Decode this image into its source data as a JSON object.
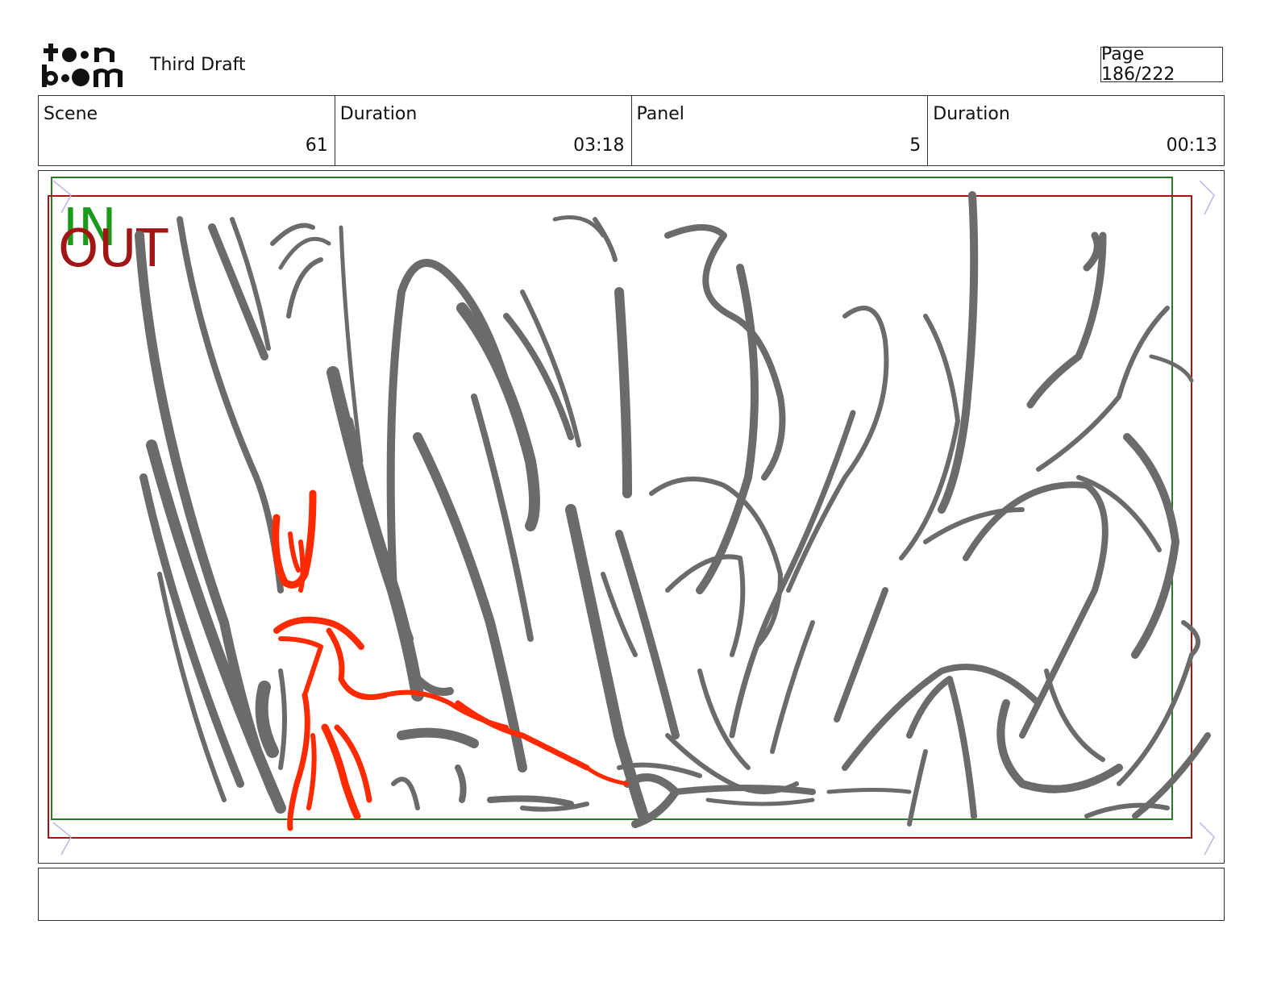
{
  "header": {
    "logo_text_top": "toon",
    "logo_text_bottom": "boom",
    "document_title": "Third Draft",
    "page_label": "Page 186/222"
  },
  "info": {
    "scene_label": "Scene",
    "scene_value": "61",
    "scene_duration_label": "Duration",
    "scene_duration_value": "03:18",
    "panel_label": "Panel",
    "panel_value": "5",
    "panel_duration_label": "Duration",
    "panel_duration_value": "00:13"
  },
  "panel": {
    "in_label": "IN",
    "out_label": "OUT",
    "in_color": "#1a9a1a",
    "out_color": "#a31515",
    "sketch_color": "#6b6b6b",
    "character_color": "#ff2a00"
  },
  "dialogue": {
    "text": ""
  }
}
